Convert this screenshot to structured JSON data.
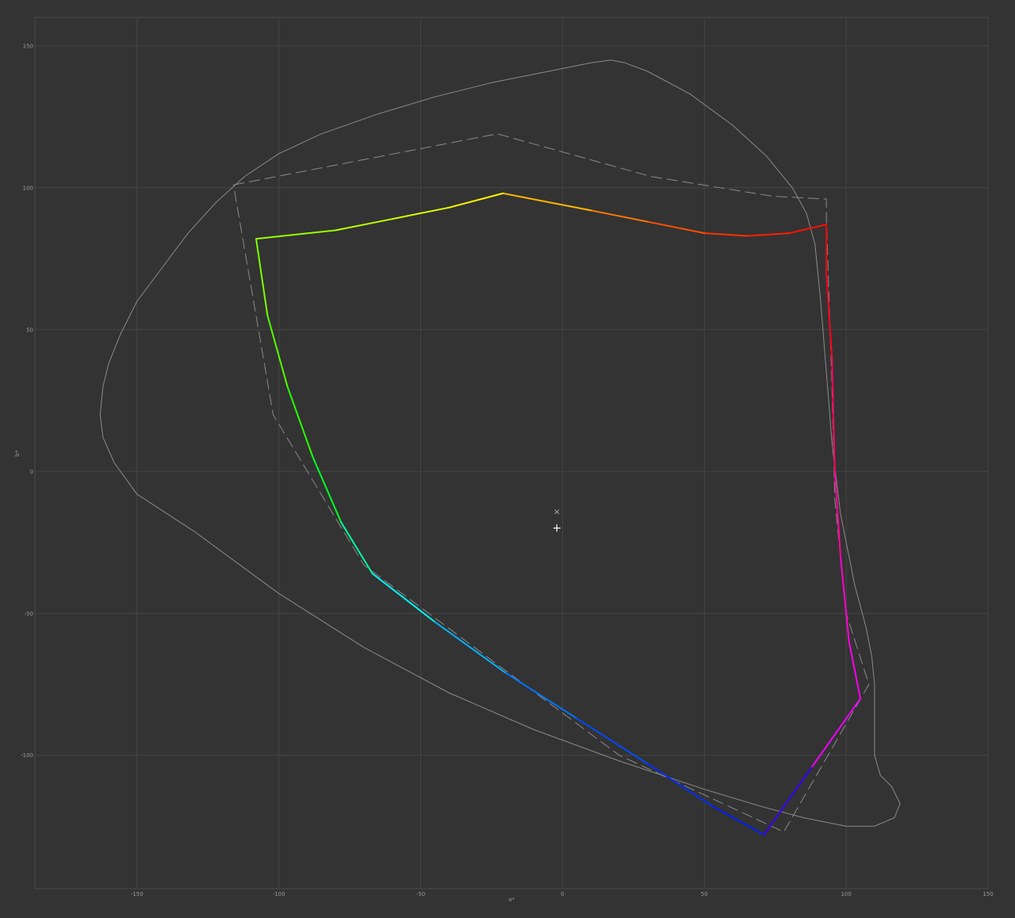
{
  "chart_data": {
    "type": "line",
    "xlabel": "a*",
    "ylabel": "b*",
    "xlim": [
      -186,
      150
    ],
    "ylim": [
      -147,
      160
    ],
    "grid": true,
    "x_ticks": [
      -150,
      -100,
      -50,
      0,
      50,
      100,
      150
    ],
    "y_ticks": [
      150,
      100,
      50,
      0,
      -50,
      -100
    ],
    "x_tick_labels": [
      "-150",
      "-100",
      "-50",
      "0",
      "50",
      "100",
      "150"
    ],
    "y_tick_labels": [
      "150",
      "100",
      "50",
      "0",
      "-50",
      "-100"
    ],
    "colors": {
      "background": "#333333",
      "grid": "#444444",
      "frame": "#4a4a4a",
      "reference": "#8a8a8a"
    },
    "series": [
      {
        "style": "solid-gray",
        "points": [
          [
            -163,
            20
          ],
          [
            -162,
            30
          ],
          [
            -160,
            38
          ],
          [
            -156,
            48
          ],
          [
            -150,
            60
          ],
          [
            -141,
            72
          ],
          [
            -132,
            84
          ],
          [
            -122,
            95
          ],
          [
            -112,
            104
          ],
          [
            -100,
            112
          ],
          [
            -85,
            119
          ],
          [
            -65,
            126
          ],
          [
            -45,
            132
          ],
          [
            -25,
            137
          ],
          [
            -5,
            141
          ],
          [
            10,
            144
          ],
          [
            17,
            145
          ],
          [
            22,
            144
          ],
          [
            30,
            141
          ],
          [
            45,
            133
          ],
          [
            60,
            122
          ],
          [
            72,
            111
          ],
          [
            81,
            100
          ],
          [
            86,
            91
          ],
          [
            89,
            80
          ],
          [
            91,
            60
          ],
          [
            93,
            35
          ],
          [
            95,
            10
          ],
          [
            98,
            -15
          ],
          [
            103,
            -40
          ],
          [
            107,
            -55
          ],
          [
            109,
            -65
          ],
          [
            110,
            -75
          ],
          [
            110,
            -90
          ],
          [
            110,
            -100
          ],
          [
            112,
            -107
          ],
          [
            116,
            -111
          ],
          [
            119,
            -117
          ],
          [
            117,
            -122
          ],
          [
            110,
            -125
          ],
          [
            100,
            -125
          ],
          [
            85,
            -122
          ],
          [
            70,
            -118
          ],
          [
            50,
            -112
          ],
          [
            20,
            -102
          ],
          [
            -10,
            -91
          ],
          [
            -40,
            -78
          ],
          [
            -70,
            -62
          ],
          [
            -100,
            -43
          ],
          [
            -130,
            -21
          ],
          [
            -150,
            -8
          ],
          [
            -158,
            3
          ],
          [
            -162,
            12
          ],
          [
            -163,
            20
          ]
        ]
      },
      {
        "style": "dashed-gray",
        "points": [
          [
            -116,
            101
          ],
          [
            -23,
            119
          ],
          [
            31,
            104
          ],
          [
            74,
            97
          ],
          [
            93,
            96
          ],
          [
            93,
            90
          ],
          [
            95,
            30
          ],
          [
            96,
            -10
          ],
          [
            100,
            -50
          ],
          [
            108,
            -75
          ],
          [
            78,
            -127
          ],
          [
            20,
            -100
          ],
          [
            -70,
            -33
          ],
          [
            -102,
            20
          ],
          [
            -116,
            101
          ]
        ]
      },
      {
        "style": "gradient-gamut",
        "points": [
          [
            93,
            87
          ],
          [
            80,
            84
          ],
          [
            65,
            83
          ],
          [
            50,
            84
          ],
          [
            30,
            88
          ],
          [
            10,
            92
          ],
          [
            -21,
            98
          ],
          [
            -40,
            93
          ],
          [
            -60,
            89
          ],
          [
            -80,
            85
          ],
          [
            -108,
            82
          ],
          [
            -104,
            55
          ],
          [
            -97,
            30
          ],
          [
            -88,
            5
          ],
          [
            -78,
            -18
          ],
          [
            -67,
            -36
          ],
          [
            -45,
            -53
          ],
          [
            -20,
            -71
          ],
          [
            5,
            -87
          ],
          [
            30,
            -103
          ],
          [
            53,
            -118
          ],
          [
            71,
            -128
          ],
          [
            88,
            -104
          ],
          [
            105,
            -80
          ],
          [
            101,
            -60
          ],
          [
            98,
            -30
          ],
          [
            96,
            0
          ],
          [
            95,
            40
          ],
          [
            93,
            70
          ],
          [
            93,
            87
          ]
        ]
      }
    ],
    "markers": [
      {
        "symbol": "×",
        "x": -2,
        "y": -14
      },
      {
        "symbol": "+",
        "x": -2,
        "y": -20
      }
    ]
  }
}
